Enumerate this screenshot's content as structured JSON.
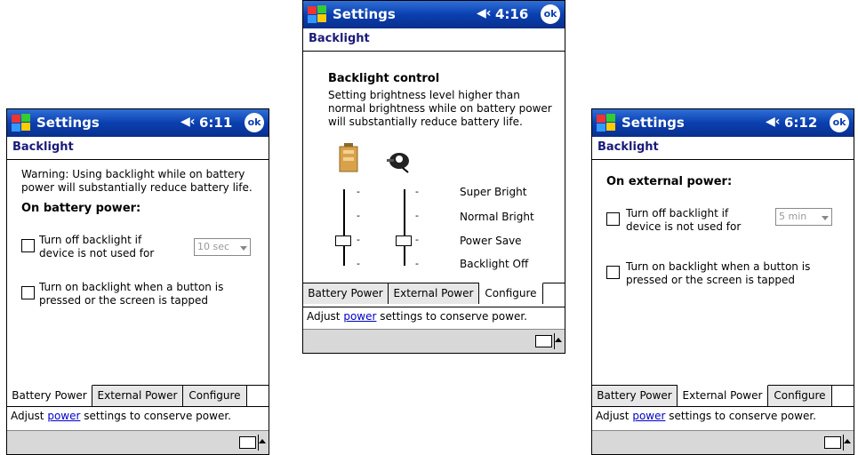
{
  "common": {
    "app_title": "Settings",
    "page_title": "Backlight",
    "ok_label": "ok",
    "speaker_icon": "◀‹",
    "tabs": [
      "Battery Power",
      "External Power",
      "Configure"
    ],
    "hint_prefix": "Adjust ",
    "hint_link": "power",
    "hint_suffix": " settings to conserve power."
  },
  "left": {
    "time": "6:11",
    "warning": "Warning: Using backlight while on battery power will substantially reduce battery life.",
    "section": "On battery power:",
    "opt1": "Turn off backlight if device is not used for",
    "opt1_value": "10 sec",
    "opt2": "Turn on backlight when a button is pressed or the screen is tapped"
  },
  "middle": {
    "time": "4:16",
    "section": "Backlight control",
    "desc": "Setting brightness level higher than normal brightness while on battery power will substantially reduce battery life.",
    "levels": [
      "Super Bright",
      "Normal Bright",
      "Power Save",
      "Backlight Off"
    ]
  },
  "right": {
    "time": "6:12",
    "section": "On external power:",
    "opt1": "Turn off backlight if device is not used for",
    "opt1_value": "5 min",
    "opt2": "Turn on backlight when a button is pressed or the screen is tapped"
  }
}
